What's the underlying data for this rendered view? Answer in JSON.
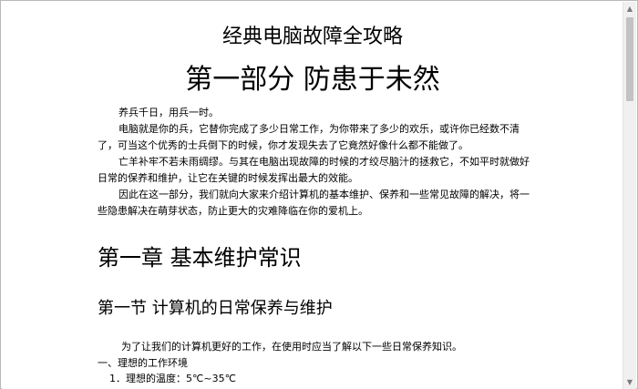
{
  "document": {
    "title": "经典电脑故障全攻略",
    "part_title": "第一部分  防患于未然",
    "paragraphs": [
      "养兵千日，用兵一时。",
      "电脑就是你的兵，它替你完成了多少日常工作，为你带来了多少的欢乐，或许你已经数不清了，可当这个优秀的士兵倒下的时候，你才发现失去了它竟然好像什么都不能做了。",
      "亡羊补牢不若未雨绸缪。与其在电脑出现故障的时候的才绞尽脑汁的拯救它，不如平时就做好日常的保养和维护，让它在关键的时候发挥出最大的效能。",
      "因此在这一部分，我们就向大家来介绍计算机的基本维护、保养和一些常见故障的解决，将一些隐患解决在萌芽状态，防止更大的灾难降临在你的爱机上。"
    ],
    "chapter_title": "第一章  基本维护常识",
    "section_title": "第一节    计算机的日常保养与维护",
    "intro_text": "为了让我们的计算机更好的工作，在使用时应当了解以下一些日常保养知识。",
    "item_heading": "一、理想的工作环境",
    "item_1": "1．理想的温度：5℃~35℃"
  },
  "scrollbar": {
    "up_arrow_icon": "triangle-up",
    "down_arrow_icon": "triangle-down"
  }
}
